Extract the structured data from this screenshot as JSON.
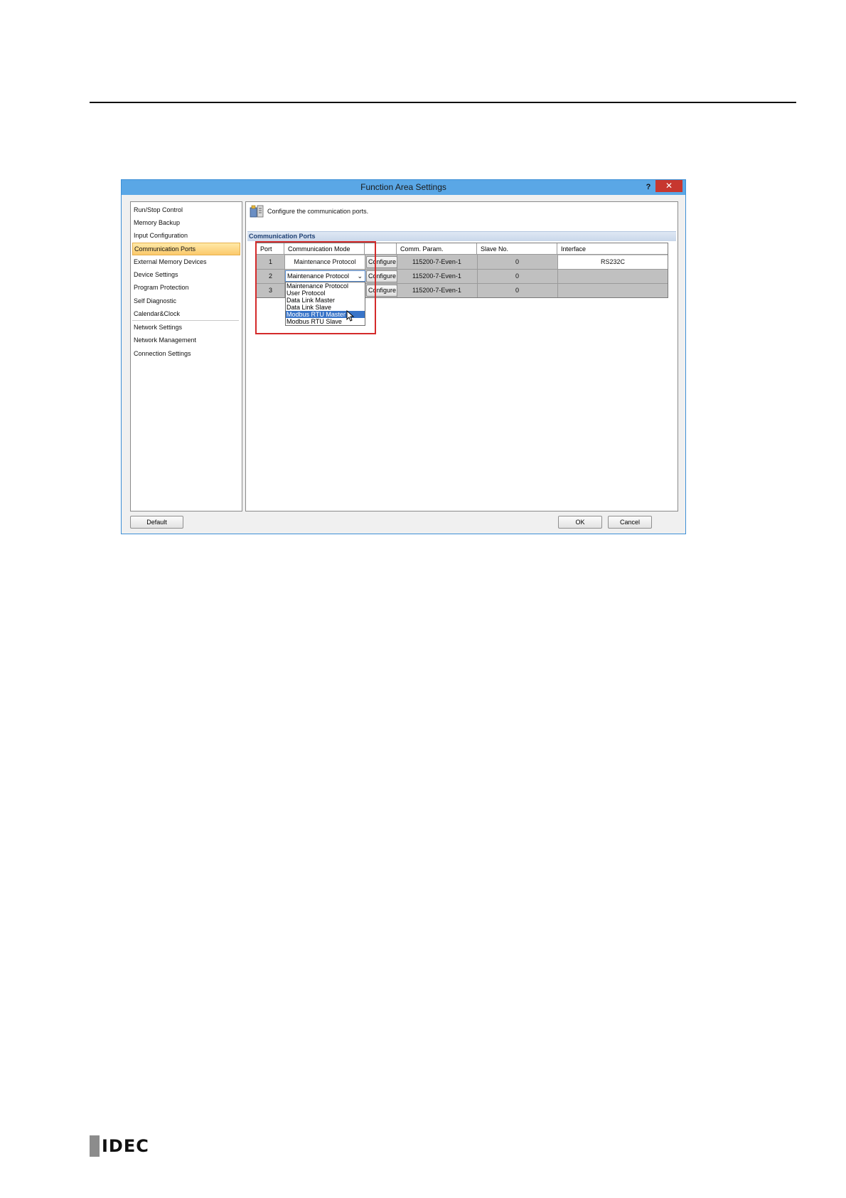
{
  "window": {
    "title": "Function Area Settings",
    "help_label": "?",
    "close_label": "✕"
  },
  "sidebar": {
    "items": [
      {
        "label": "Run/Stop Control"
      },
      {
        "label": "Memory Backup"
      },
      {
        "label": "Input Configuration"
      },
      {
        "label": "Communication Ports",
        "selected": true
      },
      {
        "label": "External Memory Devices"
      },
      {
        "label": "Device Settings"
      },
      {
        "label": "Program Protection"
      },
      {
        "label": "Self Diagnostic"
      },
      {
        "label": "Calendar&Clock"
      },
      {
        "label": "Network Settings"
      },
      {
        "label": "Network Management"
      },
      {
        "label": "Connection Settings"
      }
    ]
  },
  "main": {
    "description": "Configure the communication ports.",
    "section_title": "Communication Ports",
    "columns": [
      "Port",
      "Communication Mode",
      "",
      "Comm. Param.",
      "Slave No.",
      "Interface"
    ],
    "rows": [
      {
        "port": "1",
        "mode": "Maintenance Protocol",
        "configure": "Configure",
        "param": "115200-7-Even-1",
        "slave": "0",
        "interface": "RS232C"
      },
      {
        "port": "2",
        "mode": "Maintenance Protocol",
        "configure": "Configure",
        "param": "115200-7-Even-1",
        "slave": "0",
        "interface": ""
      },
      {
        "port": "3",
        "mode": "",
        "configure": "Configure",
        "param": "115200-7-Even-1",
        "slave": "0",
        "interface": ""
      }
    ],
    "dropdown": {
      "options": [
        "Maintenance Protocol",
        "User Protocol",
        "Data Link Master",
        "Data Link Slave",
        "Modbus RTU Master",
        "Modbus RTU Slave"
      ],
      "highlighted": "Modbus RTU Master"
    }
  },
  "footer": {
    "default_label": "Default",
    "ok_label": "OK",
    "cancel_label": "Cancel"
  },
  "brand": {
    "logo_text": "IDEC"
  },
  "colors": {
    "title_bar": "#5aa7e6",
    "close_button": "#c7372f",
    "selection": "#fbc96b",
    "highlight_box": "#d42a2a",
    "dropdown_highlight": "#3874c8"
  }
}
